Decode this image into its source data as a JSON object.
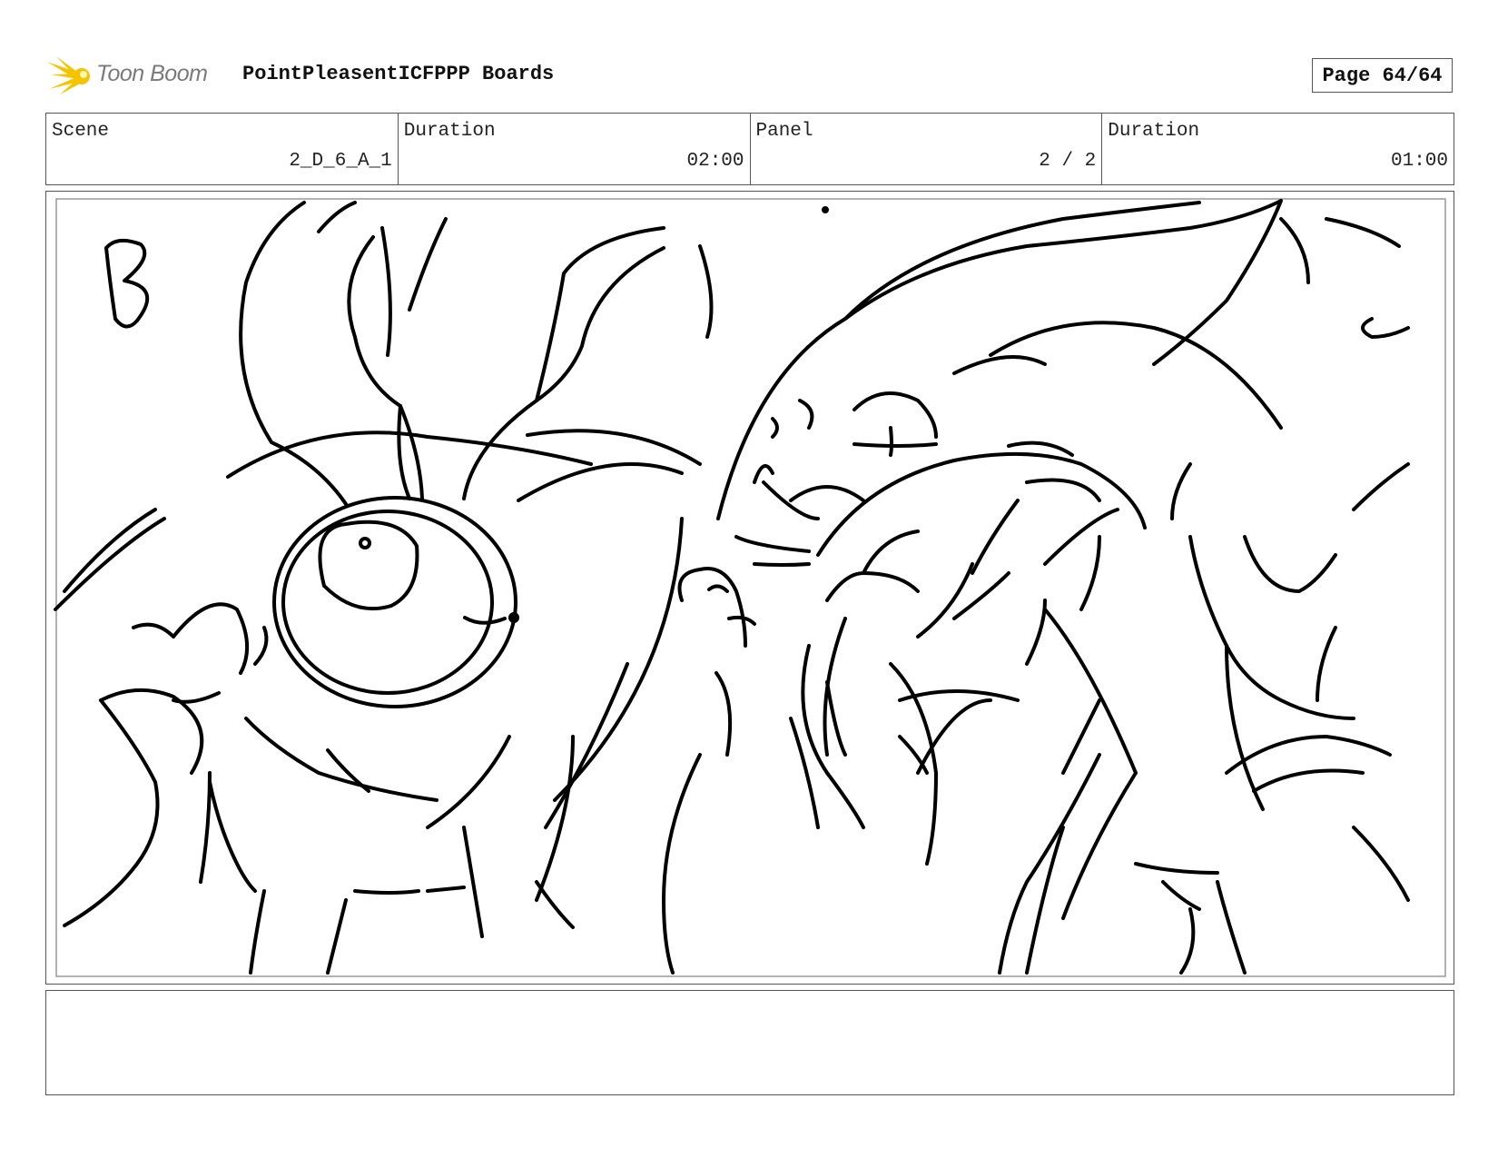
{
  "header": {
    "logo_text": "Toon Boom",
    "project_title": "PointPleasentICFPPP Boards",
    "page_label": "Page 64/64"
  },
  "info": {
    "scene_label": "Scene",
    "scene_value": "2_D_6_A_1",
    "scene_duration_label": "Duration",
    "scene_duration_value": "02:00",
    "panel_label": "Panel",
    "panel_value": "2 / 2",
    "panel_duration_label": "Duration",
    "panel_duration_value": "01:00"
  },
  "panel": {
    "marker_letter": "B"
  },
  "notes": {
    "text": ""
  },
  "colors": {
    "logo_flare": "#f5c400",
    "frame_border": "#555555",
    "sketch_line": "#000000"
  }
}
